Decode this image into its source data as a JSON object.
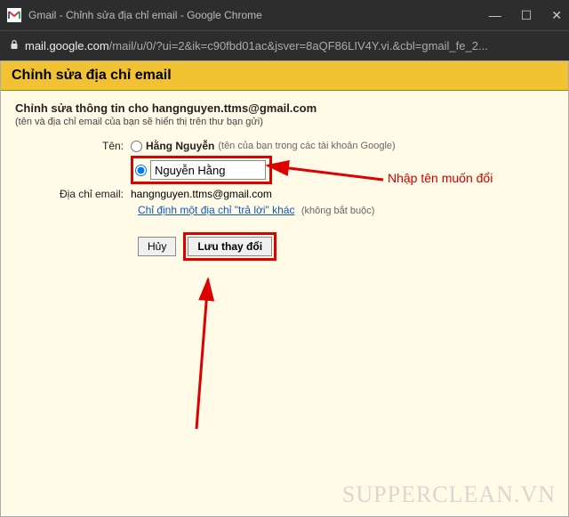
{
  "window": {
    "title": "Gmail - Chỉnh sửa địa chỉ email - Google Chrome"
  },
  "address": {
    "host": "mail.google.com",
    "path": "/mail/u/0/?ui=2&ik=c90fbd01ac&jsver=8aQF86LIV4Y.vi.&cbl=gmail_fe_2..."
  },
  "header": {
    "title": "Chỉnh sửa địa chỉ email"
  },
  "form": {
    "heading": "Chỉnh sửa thông tin cho hangnguyen.ttms@gmail.com",
    "subnote": "(tên và địa chỉ email của bạn sẽ hiển thị trên thư bạn gửi)",
    "name_label": "Tên:",
    "option1_name": "Hằng Nguyễn",
    "option1_hint": "(tên của bạn trong các tài khoản Google)",
    "option2_value": "Nguyễn Hằng",
    "email_label": "Địa chỉ email:",
    "email_value": "hangnguyen.ttms@gmail.com",
    "reply_link": "Chỉ định một địa chỉ \"trả lời\" khác",
    "reply_optional": "(không bắt buộc)",
    "cancel": "Hủy",
    "save": "Lưu thay đổi"
  },
  "annotations": {
    "a1": "Nhập tên muốn đổi"
  },
  "watermark": "SUPPERCLEAN.VN"
}
